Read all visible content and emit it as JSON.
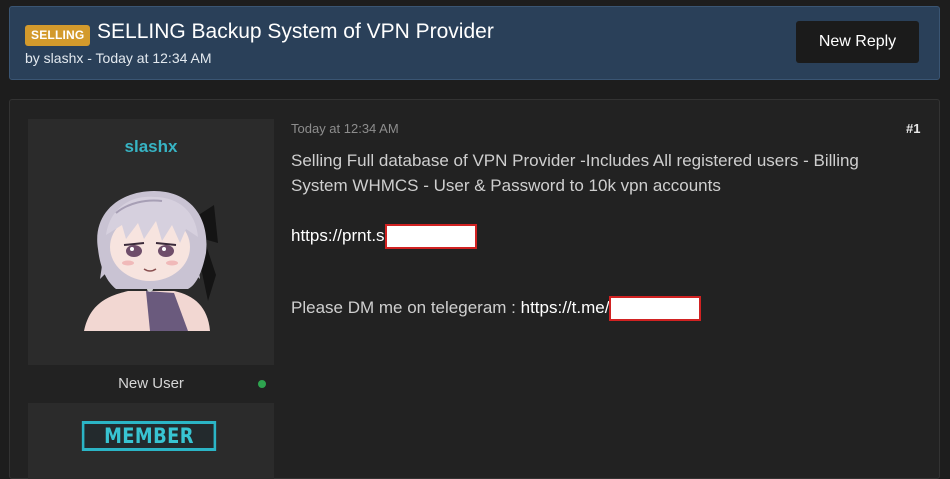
{
  "thread": {
    "prefix": "SELLING",
    "title": "SELLING Backup System of VPN Provider",
    "meta": "by slashx - Today at 12:34 AM",
    "reply_label": "New Reply",
    "prefix_color": "#d39a2c",
    "header_color": "#2a4059"
  },
  "post": {
    "username": "slashx",
    "username_color": "#37b4c4",
    "user_title": "New User",
    "online_status": "online",
    "badge_text": "MEMBER",
    "date": "Today at 12:34 AM",
    "number": "#1",
    "line1": "Selling Full database of VPN Provider -Includes All registered users - Billing System WHMCS - User & Password to 10k vpn accounts",
    "link1_prefix": "https://prnt.s",
    "dm_text": "Please DM me on telegeram : ",
    "link2_prefix": "https://t.me/"
  }
}
